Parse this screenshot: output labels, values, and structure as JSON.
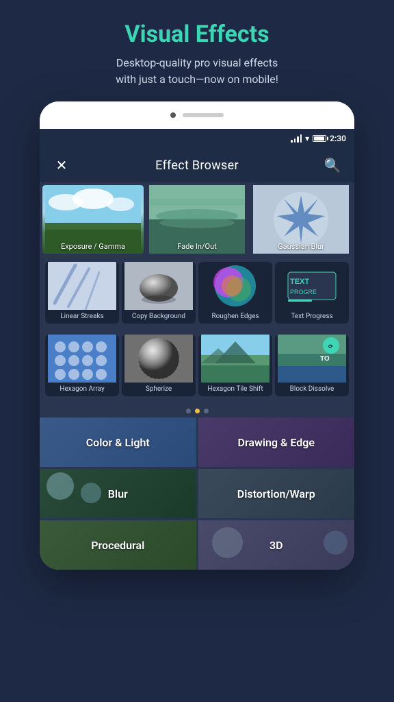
{
  "header": {
    "title": "Visual Effects",
    "subtitle": "Desktop-quality pro visual effects\nwith just a touch—now on mobile!"
  },
  "status_bar": {
    "time": "2:30"
  },
  "app_bar": {
    "title": "Effect Browser",
    "close_label": "✕",
    "search_label": "🔍"
  },
  "featured_effects": [
    {
      "name": "Exposure / Gamma",
      "thumb_type": "sky"
    },
    {
      "name": "Fade In/Out",
      "thumb_type": "lake"
    },
    {
      "name": "Gaussian Blur",
      "thumb_type": "star"
    }
  ],
  "effects_row1": [
    {
      "name": "Linear Streaks",
      "thumb_type": "linear-streaks"
    },
    {
      "name": "Copy Background",
      "thumb_type": "copy-bg"
    },
    {
      "name": "Roughen Edges",
      "thumb_type": "roughen"
    },
    {
      "name": "Text Progress",
      "thumb_type": "text-progress"
    }
  ],
  "effects_row2": [
    {
      "name": "Hexagon Array",
      "thumb_type": "hexagon"
    },
    {
      "name": "Spherize",
      "thumb_type": "spherize"
    },
    {
      "name": "Hexagon Tile Shift",
      "thumb_type": "hex-tile"
    },
    {
      "name": "Block Dissolve",
      "thumb_type": "block-dissolve"
    }
  ],
  "pagination": {
    "dots": [
      false,
      true,
      false
    ]
  },
  "categories": [
    {
      "name": "Color & Light",
      "style": "cat-color-light"
    },
    {
      "name": "Drawing & Edge",
      "style": "cat-color-drawing"
    },
    {
      "name": "Blur",
      "style": "cat-blur"
    },
    {
      "name": "Distortion/Warp",
      "style": "cat-distort"
    },
    {
      "name": "Procedural",
      "style": "cat-procedural"
    },
    {
      "name": "3D",
      "style": "cat-3d"
    }
  ]
}
